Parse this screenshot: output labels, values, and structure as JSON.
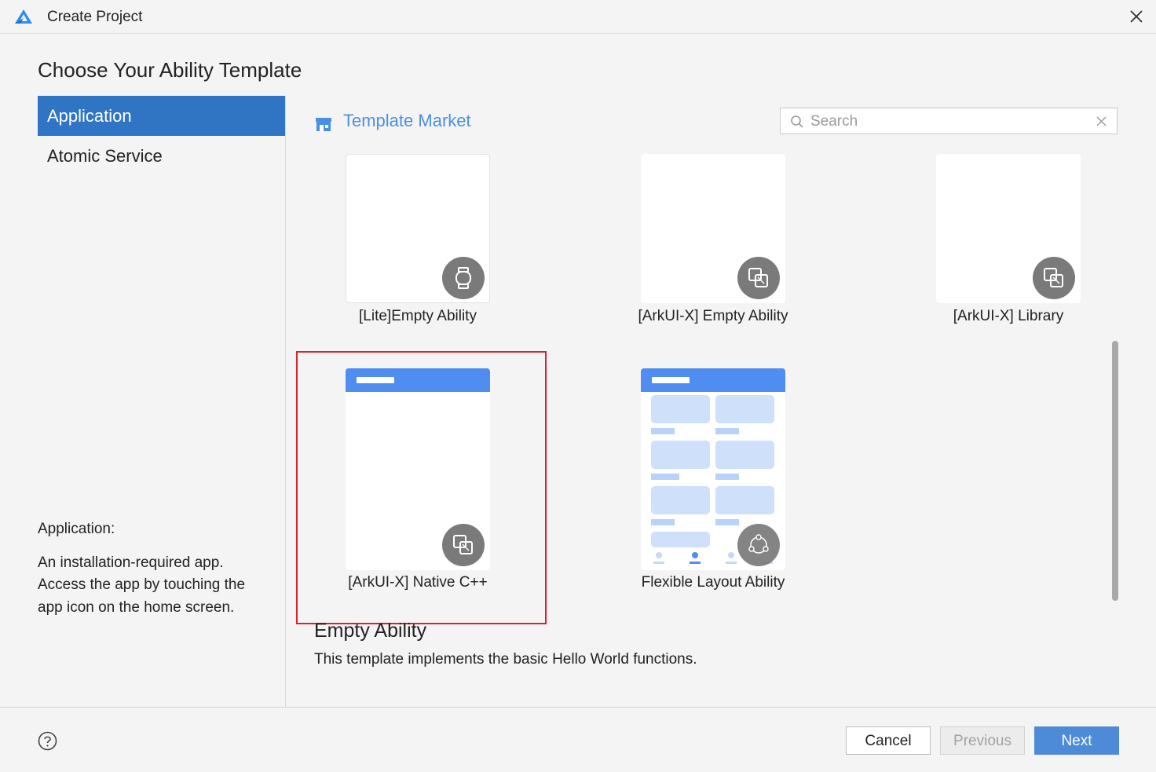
{
  "window": {
    "title": "Create Project"
  },
  "page": {
    "heading": "Choose Your Ability Template"
  },
  "sidebar": {
    "items": [
      {
        "label": "Application",
        "active": true
      },
      {
        "label": "Atomic Service",
        "active": false
      }
    ]
  },
  "description": {
    "title": "Application:",
    "text": "An installation-required app. Access the app by touching the app icon on the home screen."
  },
  "market": {
    "label": "Template Market"
  },
  "search": {
    "placeholder": "Search",
    "value": ""
  },
  "templates": [
    {
      "label": "[Lite]Empty Ability",
      "icon": "watch-icon"
    },
    {
      "label": "[ArkUI-X] Empty Ability",
      "icon": "cross-platform-icon"
    },
    {
      "label": "[ArkUI-X] Library",
      "icon": "cross-platform-icon"
    },
    {
      "label": "[ArkUI-X] Native C++",
      "icon": "cross-platform-icon",
      "selected": true
    },
    {
      "label": "Flexible Layout Ability",
      "icon": "multi-device-icon"
    }
  ],
  "detail": {
    "title": "Empty Ability",
    "text": "This template implements the basic Hello World functions."
  },
  "buttons": {
    "cancel": "Cancel",
    "previous": "Previous",
    "next": "Next"
  },
  "colors": {
    "accent": "#2f75c3",
    "link": "#4a90e2",
    "selection": "#d9232d",
    "template_header": "#4f8ef0"
  }
}
